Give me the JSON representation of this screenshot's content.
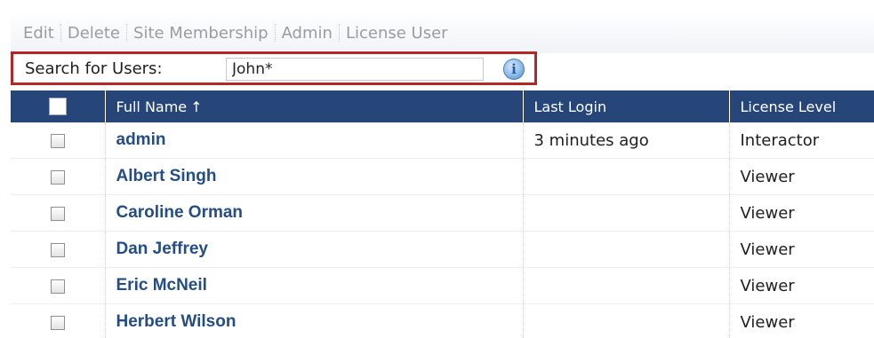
{
  "toolbar": {
    "actions": [
      "Edit",
      "Delete",
      "Site Membership",
      "Admin",
      "License User"
    ]
  },
  "search": {
    "label": "Search for Users:",
    "value": "John*"
  },
  "table": {
    "headers": {
      "full_name": "Full Name",
      "sort_indicator": "↑",
      "last_login": "Last Login",
      "license_level": "License Level"
    },
    "rows": [
      {
        "full_name": "admin",
        "last_login": "3 minutes ago",
        "license_level": "Interactor"
      },
      {
        "full_name": "Albert Singh",
        "last_login": "",
        "license_level": "Viewer"
      },
      {
        "full_name": "Caroline Orman",
        "last_login": "",
        "license_level": "Viewer"
      },
      {
        "full_name": "Dan Jeffrey",
        "last_login": "",
        "license_level": "Viewer"
      },
      {
        "full_name": "Eric McNeil",
        "last_login": "",
        "license_level": "Viewer"
      },
      {
        "full_name": "Herbert Wilson",
        "last_login": "",
        "license_level": "Viewer"
      }
    ]
  },
  "colors": {
    "header_bg": "#26467a",
    "name_link": "#244d86",
    "search_highlight": "#b32727",
    "toolbar_text": "#9c9c9c"
  },
  "icons": {
    "info": "info-icon"
  }
}
